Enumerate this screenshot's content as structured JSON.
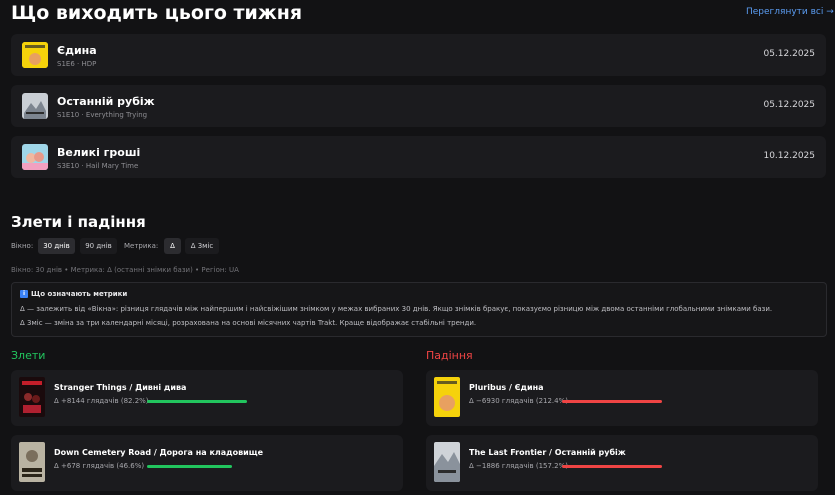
{
  "header": {
    "title": "Що виходить цього тижня",
    "see_all": "Переглянути всі →"
  },
  "episodes": [
    {
      "title": "Єдина",
      "subtitle": "S1E6 · HDP",
      "date": "05.12.2025",
      "thumb_text": "ЄДИНА"
    },
    {
      "title": "Останній рубіж",
      "subtitle": "S1E10 · Everything Trying",
      "date": "05.12.2025",
      "thumb_text": ""
    },
    {
      "title": "Великі гроші",
      "subtitle": "S3E10 · Hail Mary Time",
      "date": "10.12.2025",
      "thumb_text": ""
    }
  ],
  "trends": {
    "title": "Злети і падіння",
    "window_label": "Вікно:",
    "window_options": [
      "30 днів",
      "90 днів"
    ],
    "window_selected": "30 днів",
    "metric_label": "Метрика:",
    "metric_options": [
      "Δ",
      "Δ 3міс"
    ],
    "metric_selected": "Δ",
    "meta": "Вікно: 30 днів • Метрика: Δ (останні знімки бази) • Регіон: UA"
  },
  "info": {
    "icon": "i",
    "title": "Що означають метрики",
    "line1": "Δ — залежить від «Вікна»: різниця глядачів між найпершим і найсвіжішим знімком у межах вибраних 30 днів. Якщо знімків бракує, показуємо різницю між двома останніми глобальними знімками бази.",
    "line2": "Δ 3міс — зміна за три календарні місяці, розрахована на основі місячних чартів Trakt. Краще відображає стабільні тренди."
  },
  "rises": {
    "title": "Злети",
    "color": "#22c55e",
    "items": [
      {
        "title": "Stranger Things / Дивні дива",
        "stat": "Δ +8144 глядачів (82.2%)",
        "level": 1.0
      },
      {
        "title": "Down Cemetery Road / Дорога на кладовище",
        "stat": "Δ +678 глядачів (46.6%)",
        "level": 0.85
      }
    ]
  },
  "falls": {
    "title": "Падіння",
    "color": "#ef4444",
    "items": [
      {
        "title": "Pluribus / Єдина",
        "stat": "Δ −6930 глядачів (212.4%)",
        "level": 1.0
      },
      {
        "title": "The Last Frontier / Останній рубіж",
        "stat": "Δ −1886 глядачів (157.2%)",
        "level": 1.0
      }
    ]
  }
}
